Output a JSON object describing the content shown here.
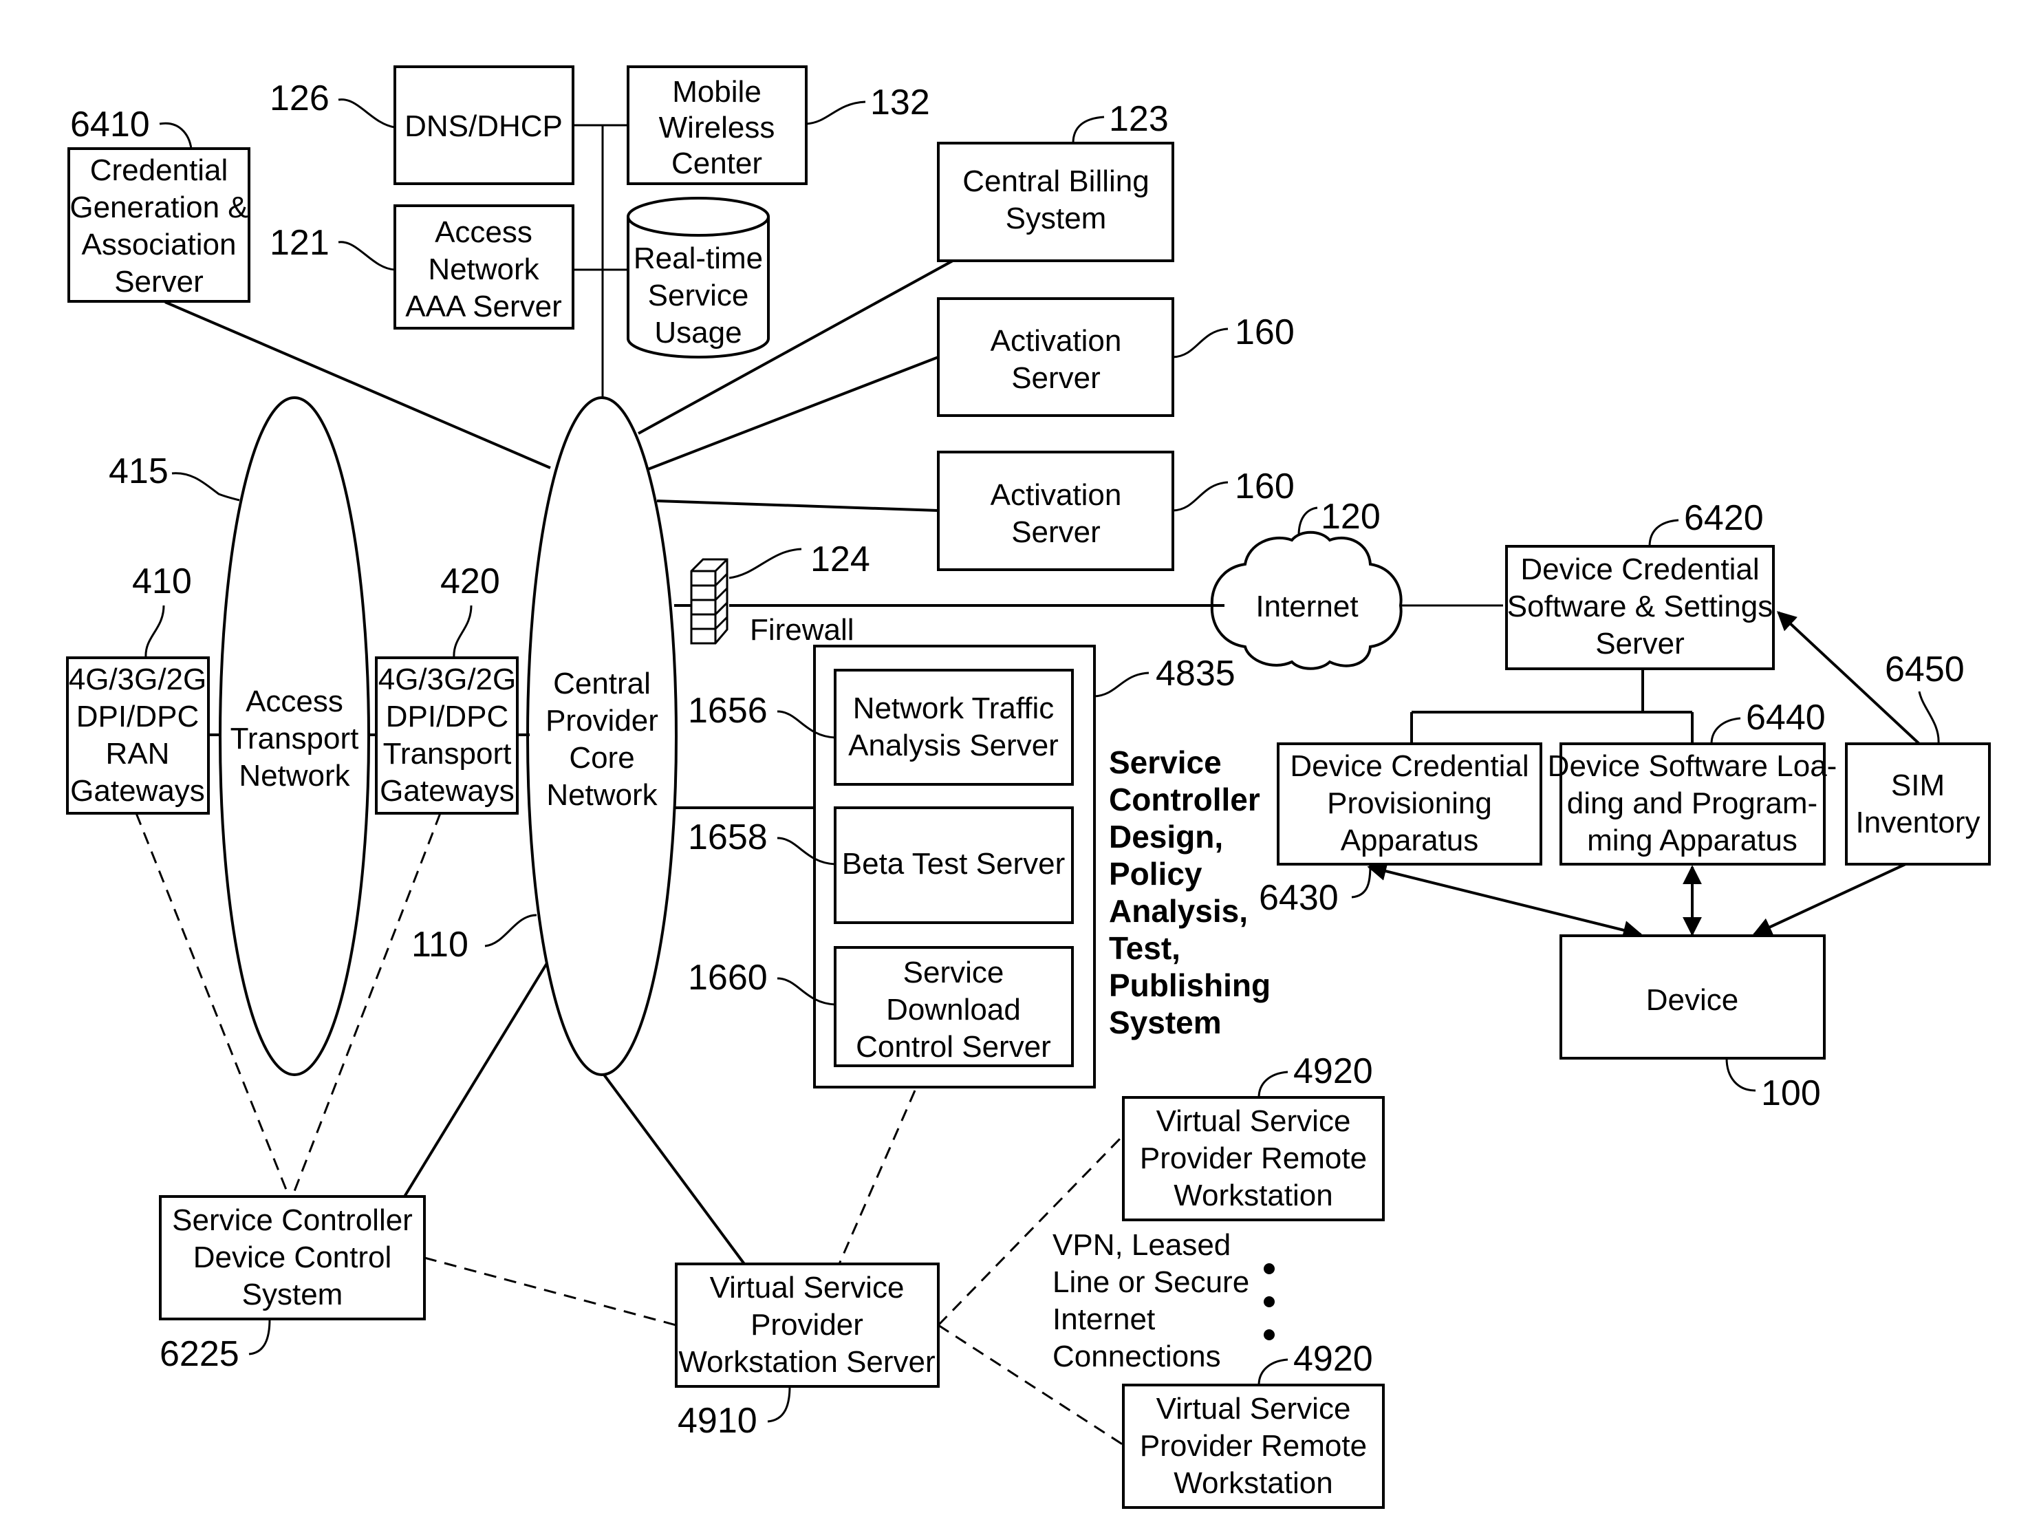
{
  "nodes": {
    "credential_generation": {
      "ref": "6410",
      "lines": [
        "Credential",
        "Generation &",
        "Association",
        "Server"
      ]
    },
    "dns_dhcp": {
      "ref": "126",
      "lines": [
        "DNS/DHCP"
      ]
    },
    "mobile_wireless_center": {
      "ref": "132",
      "lines": [
        "Mobile",
        "Wireless",
        "Center"
      ]
    },
    "access_network_aaa": {
      "ref": "121",
      "lines": [
        "Access",
        "Network",
        "AAA Server"
      ]
    },
    "realtime_service_usage": {
      "lines": [
        "Real-time",
        "Service",
        "Usage"
      ]
    },
    "central_billing": {
      "ref": "123",
      "lines": [
        "Central Billing",
        "System"
      ]
    },
    "activation_server_1": {
      "ref": "160",
      "lines": [
        "Activation",
        "Server"
      ]
    },
    "activation_server_2": {
      "ref": "160",
      "lines": [
        "Activation",
        "Server"
      ]
    },
    "access_transport_network": {
      "ref": "415",
      "lines": [
        "Access",
        "Transport",
        "Network"
      ]
    },
    "central_provider_core": {
      "ref": "110",
      "lines": [
        "Central",
        "Provider",
        "Core",
        "Network"
      ]
    },
    "ran_gateways": {
      "ref": "410",
      "lines": [
        "4G/3G/2G",
        "DPI/DPC",
        "RAN",
        "Gateways"
      ]
    },
    "transport_gateways": {
      "ref": "420",
      "lines": [
        "4G/3G/2G",
        "DPI/DPC",
        "Transport",
        "Gateways"
      ]
    },
    "firewall": {
      "ref": "124",
      "label": "Firewall"
    },
    "internet": {
      "ref": "120",
      "label": "Internet"
    },
    "service_controller_system": {
      "ref": "4835",
      "title_lines": [
        "Service",
        "Controller",
        "Design,",
        "Policy",
        "Analysis,",
        "Test,",
        "Publishing",
        "System"
      ]
    },
    "network_traffic_analysis": {
      "ref": "1656",
      "lines": [
        "Network Traffic",
        "Analysis Server"
      ]
    },
    "beta_test_server": {
      "ref": "1658",
      "lines": [
        "Beta Test Server"
      ]
    },
    "service_download_control": {
      "ref": "1660",
      "lines": [
        "Service",
        "Download",
        "Control Server"
      ]
    },
    "device_credential_software": {
      "ref": "6420",
      "lines": [
        "Device Credential",
        "Software & Settings",
        "Server"
      ]
    },
    "device_credential_provisioning": {
      "ref": "6430",
      "lines": [
        "Device Credential",
        "Provisioning",
        "Apparatus"
      ]
    },
    "device_software_loading": {
      "ref": "6440",
      "lines": [
        "Device Software Loa-",
        "ding and Program-",
        "ming Apparatus"
      ]
    },
    "sim_inventory": {
      "ref": "6450",
      "lines": [
        "SIM",
        "Inventory"
      ]
    },
    "device": {
      "ref": "100",
      "lines": [
        "Device"
      ]
    },
    "service_controller_device_control": {
      "ref": "6225",
      "lines": [
        "Service Controller",
        "Device Control",
        "System"
      ]
    },
    "vsp_workstation_server": {
      "ref": "4910",
      "lines": [
        "Virtual Service",
        "Provider",
        "Workstation Server"
      ]
    },
    "vsp_remote_workstation_1": {
      "ref": "4920",
      "lines": [
        "Virtual Service",
        "Provider Remote",
        "Workstation"
      ]
    },
    "vsp_remote_workstation_2": {
      "ref": "4920",
      "lines": [
        "Virtual Service",
        "Provider Remote",
        "Workstation"
      ]
    }
  },
  "annotations": {
    "vpn_note": [
      "VPN, Leased",
      "Line or Secure",
      "Internet",
      "Connections"
    ]
  }
}
